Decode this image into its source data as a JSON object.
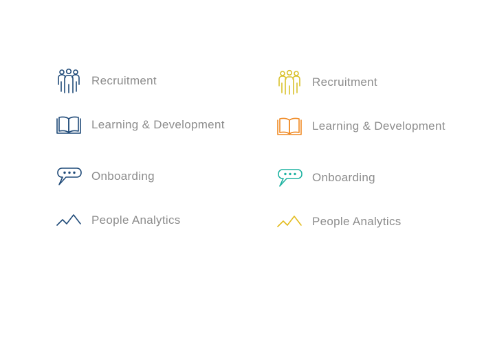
{
  "palettes": {
    "left": {
      "recruitment": "#1f4a78",
      "learning": "#1f4a78",
      "onboarding": "#1f4a78",
      "analytics": "#1f4a78"
    },
    "right": {
      "recruitment": "#d9c12a",
      "learning": "#f08a24",
      "onboarding": "#1fb3a2",
      "analytics": "#e3bb1c"
    }
  },
  "left": {
    "items": [
      {
        "icon": "people-group-icon",
        "label": "Recruitment"
      },
      {
        "icon": "open-book-icon",
        "label": "Learning & Development"
      },
      {
        "icon": "speech-bubble-icon",
        "label": "Onboarding"
      },
      {
        "icon": "zigzag-line-icon",
        "label": "People Analytics"
      }
    ]
  },
  "right": {
    "items": [
      {
        "icon": "people-group-icon",
        "label": "Recruitment"
      },
      {
        "icon": "open-book-icon",
        "label": "Learning & Development"
      },
      {
        "icon": "speech-bubble-icon",
        "label": "Onboarding"
      },
      {
        "icon": "zigzag-line-icon",
        "label": "People Analytics"
      }
    ]
  }
}
